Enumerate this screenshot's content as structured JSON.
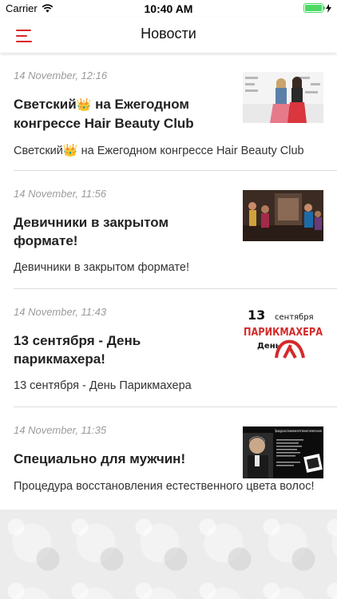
{
  "status_bar": {
    "carrier": "Carrier",
    "time": "10:40 AM",
    "battery_level": 1.0
  },
  "nav": {
    "title": "Новости",
    "menu_icon": "hamburger-menu-icon",
    "accent_color": "#d9262c"
  },
  "news": [
    {
      "date": "14 November, 12:16",
      "title_pre": "Светский",
      "title_post": " на Ежегодном конгрессе Hair Beauty Club",
      "summary_pre": "Светский",
      "summary_post": " на Ежегодном конгрессе Hair Beauty Club",
      "emoji": "👑",
      "thumb": "photo-two-women-at-congress"
    },
    {
      "date": "14 November, 11:56",
      "title": "Девичники в закрытом формате!",
      "summary": "Девичники в закрытом формате!",
      "thumb": "photo-women-in-salon"
    },
    {
      "date": "14 November, 11:43",
      "title": "13 сентября - День парикмахера!",
      "summary": "13 сентября - День Парикмахера",
      "thumb": "hairdresser-day-poster",
      "thumb_text": {
        "number": "13",
        "month": "сентября",
        "word1": "ПАРИКМАХЕРА",
        "word2": "День"
      }
    },
    {
      "date": "14 November, 11:35",
      "title": "Специально для мужчин!",
      "summary": "Процедура восстановления естественного цвета волос!",
      "thumb": "men-hair-color-flyer",
      "thumb_text": {
        "heading": "Процедура восстановления естественного пигмента волос"
      }
    }
  ]
}
